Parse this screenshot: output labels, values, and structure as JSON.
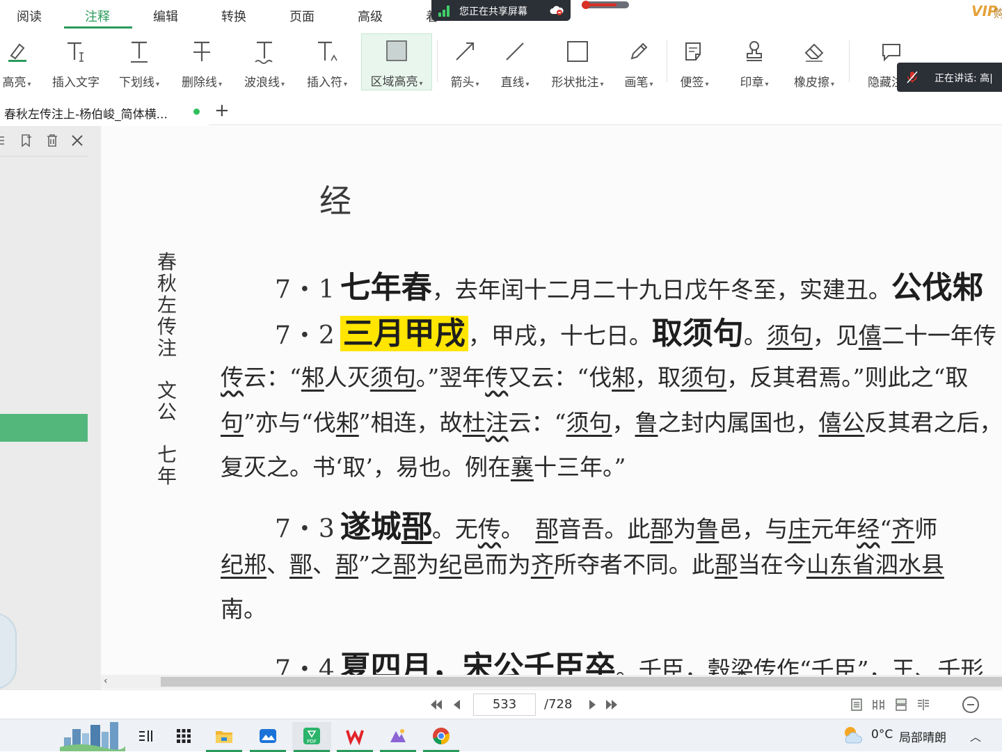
{
  "menu": {
    "tabs": [
      "阅读",
      "注释",
      "编辑",
      "转换",
      "页面",
      "高级",
      "着"
    ],
    "active_tab": "注释",
    "share_notice": "您正在共享屏幕",
    "vip_badge": "VIP",
    "vip_text": "购"
  },
  "toolbar": {
    "tools": [
      {
        "label": "高亮",
        "icon": "highlighter-icon",
        "dropdown": true
      },
      {
        "label": "插入文字",
        "icon": "insert-text-icon",
        "dropdown": false
      },
      {
        "label": "下划线",
        "icon": "underline-icon",
        "dropdown": true
      },
      {
        "label": "删除线",
        "icon": "strikethrough-icon",
        "dropdown": true
      },
      {
        "label": "波浪线",
        "icon": "wavy-line-icon",
        "dropdown": true
      },
      {
        "label": "插入符",
        "icon": "caret-insert-icon",
        "dropdown": true
      },
      {
        "label": "区域高亮",
        "icon": "area-highlight-icon",
        "dropdown": true,
        "selected": true
      },
      {
        "label": "箭头",
        "icon": "arrow-icon",
        "dropdown": true
      },
      {
        "label": "直线",
        "icon": "line-icon",
        "dropdown": true
      },
      {
        "label": "形状批注",
        "icon": "shape-icon",
        "dropdown": true
      },
      {
        "label": "画笔",
        "icon": "pen-icon",
        "dropdown": true
      },
      {
        "label": "便签",
        "icon": "sticky-note-icon",
        "dropdown": true
      },
      {
        "label": "印章",
        "icon": "stamp-icon",
        "dropdown": true
      },
      {
        "label": "橡皮擦",
        "icon": "eraser-icon",
        "dropdown": true
      },
      {
        "label": "隐藏注释",
        "icon": "hide-annotation-icon",
        "dropdown": false
      }
    ],
    "speaking_label": "正在讲话:",
    "speaking_name": "高|"
  },
  "document_tab": {
    "title": "春秋左传注上-杨伯峻_简体横...",
    "new_tab": "+"
  },
  "page_content": {
    "side_title": [
      "春",
      "秋",
      "左",
      "传",
      "注",
      "",
      "文",
      "公",
      "",
      "七",
      "年"
    ],
    "heading": "经",
    "entries": {
      "e71_num": "7・1",
      "e71_big": "七年春",
      "e71_rest": "，去年闰十二月二十九日戊午冬至，实建丑。",
      "e71_tail": "公伐邾",
      "e72_num": "7・2",
      "e72_hl": "三月甲戌",
      "e72_rest": "，甲戌，十七日。",
      "e72_big": "取须句",
      "e72_tail_a": "。",
      "e72_tail_b": "须句",
      "e72_tail_c": "，见",
      "e72_tail_d": "僖",
      "e72_tail_e": "二十一年传",
      "l3_a": "传",
      "l3_b": "云：“",
      "l3_c": "邾",
      "l3_d": "人灭",
      "l3_e": "须句",
      "l3_f": "。”翌年",
      "l3_g": "传",
      "l3_h": "又云：“伐",
      "l3_i": "邾",
      "l3_j": "，取",
      "l3_k": "须句",
      "l3_l": "，反其君焉。”则此之“取",
      "l4_a": "句",
      "l4_b": "”亦与“伐",
      "l4_c": "邾",
      "l4_d": "”相连，故",
      "l4_e": "杜",
      "l4_f": "注",
      "l4_g": "云：“",
      "l4_h": "须句",
      "l4_i": "，",
      "l4_j": "鲁",
      "l4_k": "之封内属国也，",
      "l4_l": "僖公",
      "l4_m": "反其君之后，",
      "l5_a": "复灭之。书‘取’，易也。例在",
      "l5_b": "襄",
      "l5_c": "十三年。”",
      "e73_num": "7・3",
      "e73_big_a": "遂城",
      "e73_big_b": "郚",
      "e73_rest_a": "。无",
      "e73_rest_b": "传",
      "e73_rest_c": "。　",
      "e73_rest_d": "郚",
      "e73_rest_e": "音吾。此",
      "e73_rest_f": "郚",
      "e73_rest_g": "为",
      "e73_rest_h": "鲁",
      "e73_rest_i": "邑，与",
      "e73_rest_j": "庄",
      "e73_rest_k": "元年",
      "e73_rest_l": "经",
      "e73_rest_m": "“",
      "e73_rest_n": "齐",
      "e73_rest_o": "师",
      "l7_a": "纪",
      "l7_b": "郱",
      "l7_c": "、",
      "l7_d": "鄑",
      "l7_e": "、",
      "l7_f": "郚",
      "l7_g": "”之",
      "l7_h": "郚",
      "l7_i": "为",
      "l7_j": "纪",
      "l7_k": "邑而为",
      "l7_l": "齐",
      "l7_m": "所夺者不同。此",
      "l7_n": "郚",
      "l7_o": "当在今",
      "l7_p": "山东省泗水县",
      "l8": "南。",
      "e74_num": "7・4",
      "e74_big": "夏四月，宋公壬臣卒",
      "e74_rest": "。壬臣，穀梁传作“壬臣”，王、壬形"
    }
  },
  "navigation": {
    "current_page": "533",
    "total_pages": "/728"
  },
  "taskbar": {
    "apps": [
      "taskview-icon",
      "start-grid-icon",
      "file-explorer-icon",
      "photos-icon",
      "pdf-reader-icon",
      "wps-icon",
      "paint-icon",
      "chrome-icon"
    ],
    "running": [
      "file-explorer-icon",
      "photos-icon",
      "pdf-reader-icon",
      "wps-icon",
      "paint-icon",
      "chrome-icon"
    ],
    "weather_temp": "0°C",
    "weather_desc": "局部晴朗"
  },
  "colors": {
    "accent": "#2a9a5c",
    "highlight": "#ffe500",
    "bookmark": "#53b77b"
  }
}
